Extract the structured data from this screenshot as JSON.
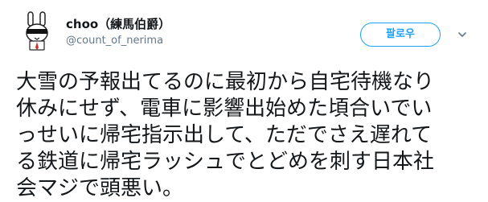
{
  "user": {
    "display_name": "choo（練馬伯爵）",
    "screen_name": "@count_of_nerima",
    "avatar_icon": "rabbit-with-sunglasses-avatar"
  },
  "actions": {
    "follow_label": "팔로우",
    "caret_icon": "chevron-down-icon"
  },
  "tweet": {
    "lines": [
      "大雪の予報出てるのに最初から自宅待機なり",
      "休みにせず、電車に影響出始めた頃合いでい",
      "っせいに帰宅指示出して、ただでさえ遅れて",
      "る鉄道に帰宅ラッシュでとどめを刺す日本社",
      "会マジで頭悪い。"
    ]
  },
  "colors": {
    "accent": "#1da1f2",
    "text": "#14171a",
    "muted": "#657786"
  }
}
